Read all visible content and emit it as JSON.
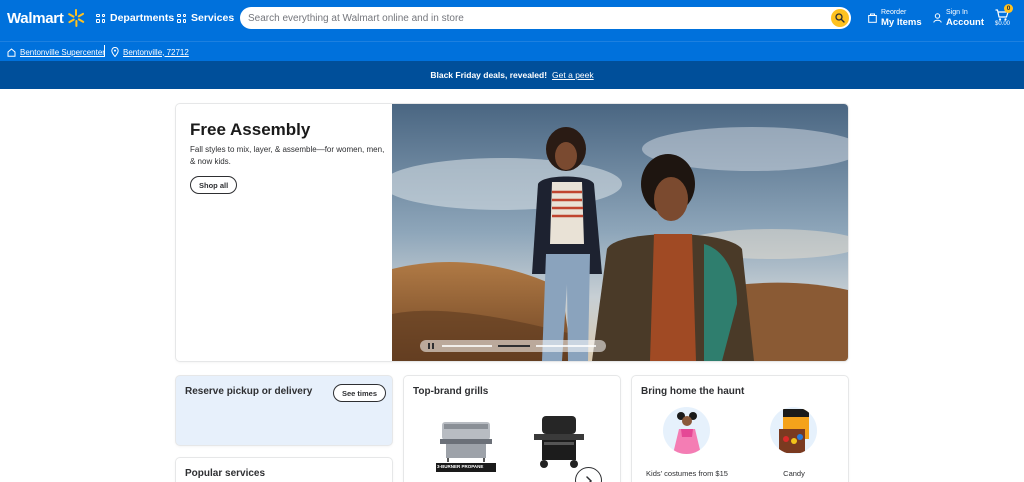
{
  "header": {
    "logo_text": "Walmart",
    "departments_label": "Departments",
    "services_label": "Services",
    "search_placeholder": "Search everything at Walmart online and in store",
    "reorder_small": "Reorder",
    "reorder_big": "My Items",
    "account_small": "Sign In",
    "account_big": "Account",
    "cart_count": "0",
    "cart_total": "$0.00"
  },
  "location": {
    "store": "Bentonville Supercenter",
    "address": "Bentonville, 72712"
  },
  "promo": {
    "text": "Black Friday deals, revealed!",
    "link": "Get a peek"
  },
  "hero": {
    "title": "Free Assembly",
    "subtitle": "Fall styles to mix, layer, & assemble—for women, men, & now kids.",
    "button": "Shop all"
  },
  "cards": {
    "pickup": {
      "title": "Reserve pickup or delivery",
      "button": "See times"
    },
    "popular": {
      "title": "Popular services"
    },
    "grills": {
      "title": "Top-brand grills",
      "grill_badge": "3-BURNER PROPANE"
    },
    "haunt": {
      "title": "Bring home the haunt",
      "items": [
        {
          "label": "Kids' costumes from $15"
        },
        {
          "label": "Candy"
        }
      ]
    }
  },
  "colors": {
    "brand_blue": "#0071dc",
    "dark_blue": "#004f9a",
    "spark_yellow": "#ffc220",
    "pickup_bg": "#e7f0fb"
  },
  "icons": [
    "spark-logo-icon",
    "grid-icon",
    "search-icon",
    "reorder-icon",
    "account-icon",
    "cart-icon",
    "store-icon",
    "pin-icon",
    "pause-icon",
    "chevron-right-icon"
  ]
}
